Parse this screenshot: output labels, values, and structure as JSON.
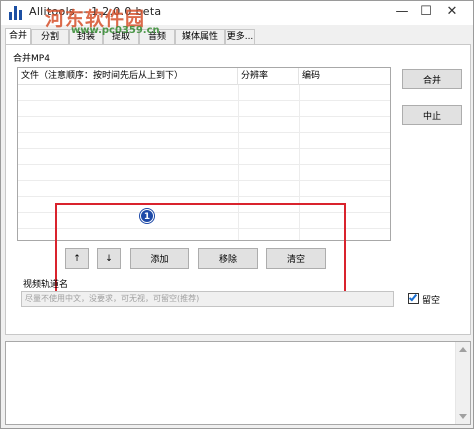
{
  "app": {
    "title": "Allitools -- 1.2.0.0 beta"
  },
  "watermark": {
    "site_name": "河东软件园",
    "url": "www.pc0359.cn"
  },
  "window_controls": {
    "minimize": "—",
    "maximize": "☐",
    "close": "✕"
  },
  "tabs": [
    {
      "label": "合并",
      "active": true
    },
    {
      "label": "分割",
      "active": false
    },
    {
      "label": "封装",
      "active": false
    },
    {
      "label": "提取",
      "active": false
    },
    {
      "label": "音频",
      "active": false
    },
    {
      "label": "媒体属性",
      "active": false
    },
    {
      "label": "更多...",
      "active": false
    }
  ],
  "merge": {
    "group_label": "合并MP4",
    "columns": [
      "文件（注意顺序：按时间先后从上到下）",
      "分辨率",
      "编码"
    ],
    "rows": [],
    "merge_button": "合并",
    "stop_button": "中止",
    "move_up_button": "↑",
    "move_down_button": "↓",
    "add_button": "添加",
    "remove_button": "移除",
    "clear_button": "清空",
    "annotation_badge": "1",
    "track_name_label": "视频轨道名",
    "track_name_placeholder": "尽量不使用中文，没要求，可无视，可留空(推荐)",
    "leave_empty_label": "留空",
    "leave_empty_checked": true
  },
  "colors": {
    "annotation": "#d9232d",
    "badge": "#1e4aa8"
  }
}
